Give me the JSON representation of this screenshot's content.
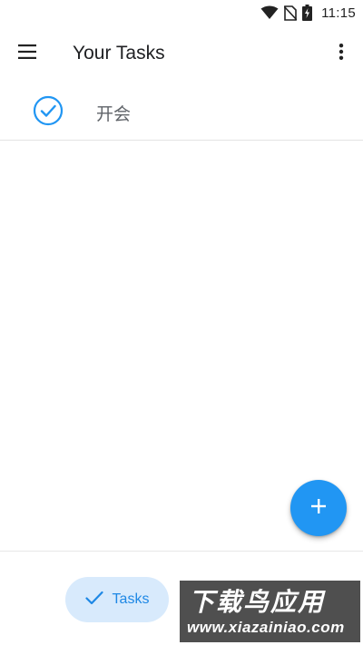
{
  "status_bar": {
    "time": "11:15",
    "icons": [
      "wifi-icon",
      "no-sim-icon",
      "battery-charging-icon"
    ]
  },
  "app_bar": {
    "menu_icon": "hamburger-menu-icon",
    "title": "Your Tasks",
    "more_icon": "more-vertical-icon"
  },
  "tasks": [
    {
      "label": "开会",
      "icon": "check-circle-icon"
    }
  ],
  "fab": {
    "icon": "plus-icon"
  },
  "bottom_nav": {
    "tasks_label": "Tasks",
    "tasks_icon": "check-icon"
  },
  "watermark": {
    "title": "下载鸟应用",
    "url": "www.xiazainiao.com"
  },
  "colors": {
    "accent": "#2196f3",
    "nav_pill": "#d8eafc",
    "nav_text": "#1e88e5"
  }
}
